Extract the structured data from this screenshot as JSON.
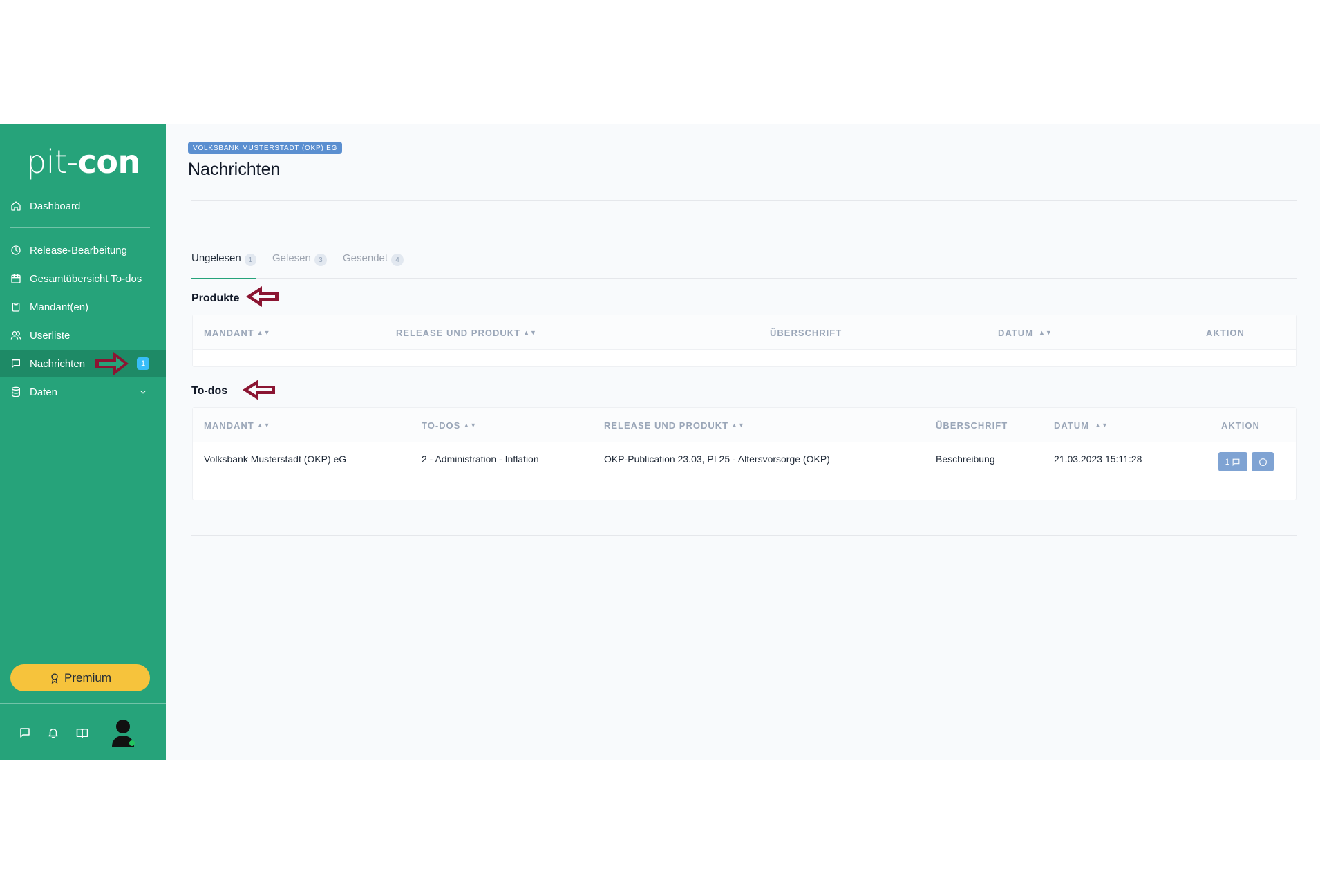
{
  "sidebar": {
    "logo_thin": "pit-",
    "logo_bold": "con",
    "items": [
      {
        "label": "Dashboard",
        "icon": "home-icon"
      },
      {
        "label": "Release-Bearbeitung",
        "icon": "clock-icon"
      },
      {
        "label": "Gesamtübersicht To-dos",
        "icon": "calendar-icon"
      },
      {
        "label": "Mandant(en)",
        "icon": "clipboard-icon"
      },
      {
        "label": "Userliste",
        "icon": "users-icon"
      },
      {
        "label": "Nachrichten",
        "icon": "message-icon",
        "badge": "1",
        "active": true
      },
      {
        "label": "Daten",
        "icon": "database-icon"
      }
    ],
    "premium_label": "Premium"
  },
  "header": {
    "client_badge": "VOLKSBANK MUSTERSTADT (OKP) EG",
    "title": "Nachrichten"
  },
  "tabs": [
    {
      "label": "Ungelesen",
      "count": "1",
      "active": true
    },
    {
      "label": "Gelesen",
      "count": "3"
    },
    {
      "label": "Gesendet",
      "count": "4"
    }
  ],
  "produkte": {
    "title": "Produkte",
    "columns": [
      "MANDANT",
      "RELEASE UND PRODUKT",
      "ÜBERSCHRIFT",
      "DATUM",
      "AKTION"
    ]
  },
  "todos": {
    "title": "To-dos",
    "columns": [
      "MANDANT",
      "TO-DOS",
      "RELEASE UND PRODUKT",
      "ÜBERSCHRIFT",
      "DATUM",
      "AKTION"
    ],
    "rows": [
      {
        "mandant": "Volksbank Musterstadt (OKP) eG",
        "todo": "2 - Administration - Inflation",
        "release": "OKP-Publication 23.03, PI 25 - Altersvorsorge (OKP)",
        "ueberschrift": "Beschreibung",
        "datum": "21.03.2023 15:11:28",
        "reply_count": "1"
      }
    ]
  },
  "colors": {
    "sidebar": "#26a37a",
    "sidebar_active": "#1e8a66",
    "premium": "#f6c33c",
    "annotation_arrow": "#8b1532"
  }
}
